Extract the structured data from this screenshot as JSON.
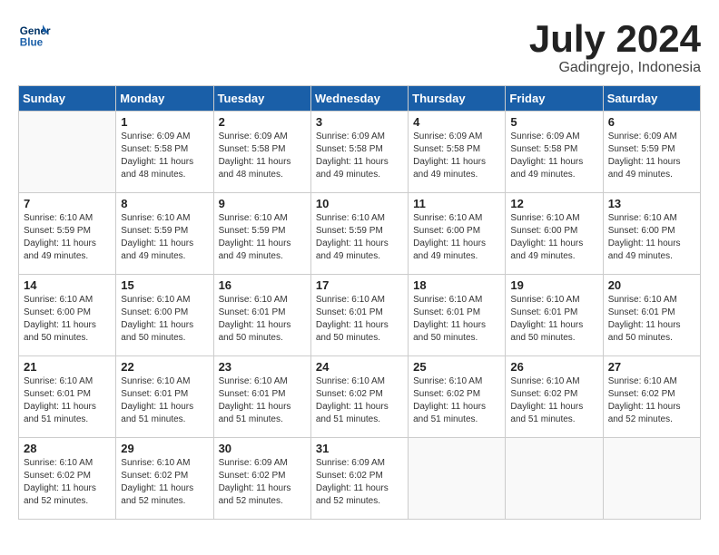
{
  "header": {
    "logo_line1": "General",
    "logo_line2": "Blue",
    "month": "July 2024",
    "location": "Gadingrejo, Indonesia"
  },
  "days_of_week": [
    "Sunday",
    "Monday",
    "Tuesday",
    "Wednesday",
    "Thursday",
    "Friday",
    "Saturday"
  ],
  "weeks": [
    [
      {
        "day": "",
        "info": ""
      },
      {
        "day": "1",
        "info": "Sunrise: 6:09 AM\nSunset: 5:58 PM\nDaylight: 11 hours\nand 48 minutes."
      },
      {
        "day": "2",
        "info": "Sunrise: 6:09 AM\nSunset: 5:58 PM\nDaylight: 11 hours\nand 48 minutes."
      },
      {
        "day": "3",
        "info": "Sunrise: 6:09 AM\nSunset: 5:58 PM\nDaylight: 11 hours\nand 49 minutes."
      },
      {
        "day": "4",
        "info": "Sunrise: 6:09 AM\nSunset: 5:58 PM\nDaylight: 11 hours\nand 49 minutes."
      },
      {
        "day": "5",
        "info": "Sunrise: 6:09 AM\nSunset: 5:58 PM\nDaylight: 11 hours\nand 49 minutes."
      },
      {
        "day": "6",
        "info": "Sunrise: 6:09 AM\nSunset: 5:59 PM\nDaylight: 11 hours\nand 49 minutes."
      }
    ],
    [
      {
        "day": "7",
        "info": "Sunrise: 6:10 AM\nSunset: 5:59 PM\nDaylight: 11 hours\nand 49 minutes."
      },
      {
        "day": "8",
        "info": "Sunrise: 6:10 AM\nSunset: 5:59 PM\nDaylight: 11 hours\nand 49 minutes."
      },
      {
        "day": "9",
        "info": "Sunrise: 6:10 AM\nSunset: 5:59 PM\nDaylight: 11 hours\nand 49 minutes."
      },
      {
        "day": "10",
        "info": "Sunrise: 6:10 AM\nSunset: 5:59 PM\nDaylight: 11 hours\nand 49 minutes."
      },
      {
        "day": "11",
        "info": "Sunrise: 6:10 AM\nSunset: 6:00 PM\nDaylight: 11 hours\nand 49 minutes."
      },
      {
        "day": "12",
        "info": "Sunrise: 6:10 AM\nSunset: 6:00 PM\nDaylight: 11 hours\nand 49 minutes."
      },
      {
        "day": "13",
        "info": "Sunrise: 6:10 AM\nSunset: 6:00 PM\nDaylight: 11 hours\nand 49 minutes."
      }
    ],
    [
      {
        "day": "14",
        "info": "Sunrise: 6:10 AM\nSunset: 6:00 PM\nDaylight: 11 hours\nand 50 minutes."
      },
      {
        "day": "15",
        "info": "Sunrise: 6:10 AM\nSunset: 6:00 PM\nDaylight: 11 hours\nand 50 minutes."
      },
      {
        "day": "16",
        "info": "Sunrise: 6:10 AM\nSunset: 6:01 PM\nDaylight: 11 hours\nand 50 minutes."
      },
      {
        "day": "17",
        "info": "Sunrise: 6:10 AM\nSunset: 6:01 PM\nDaylight: 11 hours\nand 50 minutes."
      },
      {
        "day": "18",
        "info": "Sunrise: 6:10 AM\nSunset: 6:01 PM\nDaylight: 11 hours\nand 50 minutes."
      },
      {
        "day": "19",
        "info": "Sunrise: 6:10 AM\nSunset: 6:01 PM\nDaylight: 11 hours\nand 50 minutes."
      },
      {
        "day": "20",
        "info": "Sunrise: 6:10 AM\nSunset: 6:01 PM\nDaylight: 11 hours\nand 50 minutes."
      }
    ],
    [
      {
        "day": "21",
        "info": "Sunrise: 6:10 AM\nSunset: 6:01 PM\nDaylight: 11 hours\nand 51 minutes."
      },
      {
        "day": "22",
        "info": "Sunrise: 6:10 AM\nSunset: 6:01 PM\nDaylight: 11 hours\nand 51 minutes."
      },
      {
        "day": "23",
        "info": "Sunrise: 6:10 AM\nSunset: 6:01 PM\nDaylight: 11 hours\nand 51 minutes."
      },
      {
        "day": "24",
        "info": "Sunrise: 6:10 AM\nSunset: 6:02 PM\nDaylight: 11 hours\nand 51 minutes."
      },
      {
        "day": "25",
        "info": "Sunrise: 6:10 AM\nSunset: 6:02 PM\nDaylight: 11 hours\nand 51 minutes."
      },
      {
        "day": "26",
        "info": "Sunrise: 6:10 AM\nSunset: 6:02 PM\nDaylight: 11 hours\nand 51 minutes."
      },
      {
        "day": "27",
        "info": "Sunrise: 6:10 AM\nSunset: 6:02 PM\nDaylight: 11 hours\nand 52 minutes."
      }
    ],
    [
      {
        "day": "28",
        "info": "Sunrise: 6:10 AM\nSunset: 6:02 PM\nDaylight: 11 hours\nand 52 minutes."
      },
      {
        "day": "29",
        "info": "Sunrise: 6:10 AM\nSunset: 6:02 PM\nDaylight: 11 hours\nand 52 minutes."
      },
      {
        "day": "30",
        "info": "Sunrise: 6:09 AM\nSunset: 6:02 PM\nDaylight: 11 hours\nand 52 minutes."
      },
      {
        "day": "31",
        "info": "Sunrise: 6:09 AM\nSunset: 6:02 PM\nDaylight: 11 hours\nand 52 minutes."
      },
      {
        "day": "",
        "info": ""
      },
      {
        "day": "",
        "info": ""
      },
      {
        "day": "",
        "info": ""
      }
    ]
  ]
}
